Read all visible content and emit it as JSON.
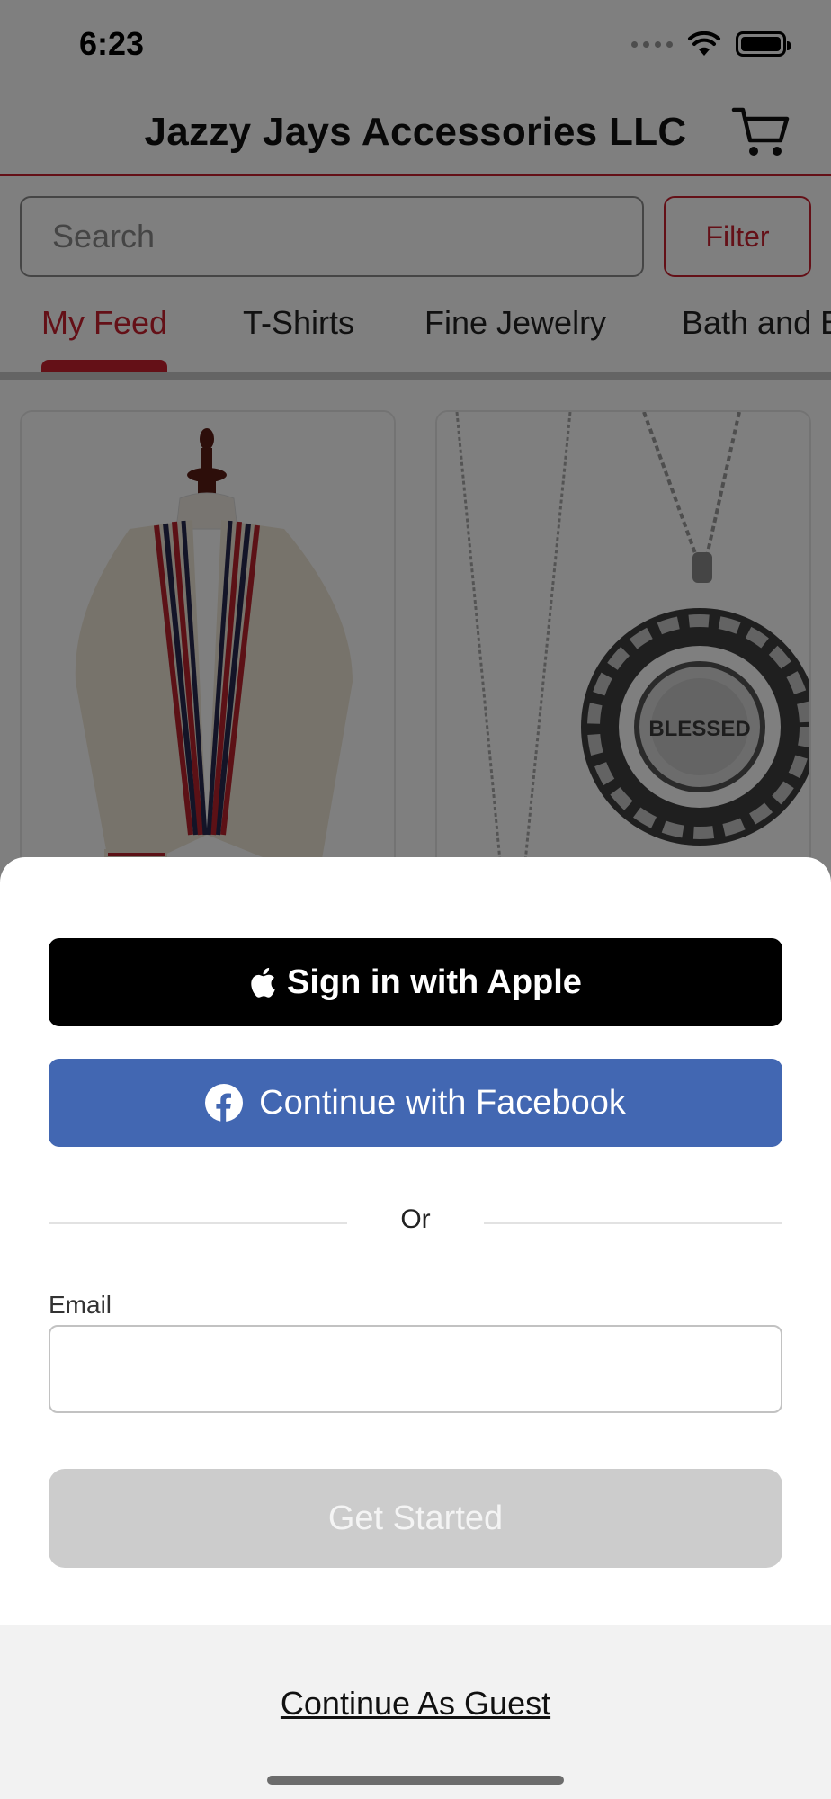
{
  "status_bar": {
    "time": "6:23"
  },
  "header": {
    "title": "Jazzy Jays Accessories LLC"
  },
  "search": {
    "placeholder": "Search",
    "filter_label": "Filter"
  },
  "tabs": [
    {
      "label": "My Feed",
      "active": true
    },
    {
      "label": "T-Shirts",
      "active": false
    },
    {
      "label": "Fine Jewelry",
      "active": false
    },
    {
      "label": "Bath and B",
      "active": false
    }
  ],
  "products": [
    {
      "image": "striped-vest-on-mannequin"
    },
    {
      "image": "blessed-pendant-necklace",
      "engraving": "BLESSED"
    }
  ],
  "sheet": {
    "apple_label": "Sign in with Apple",
    "facebook_label": "Continue with Facebook",
    "or_text": "Or",
    "email_label": "Email",
    "email_value": "",
    "get_started_label": "Get Started",
    "guest_label": "Continue As Guest"
  },
  "colors": {
    "accent_red": "#c8202e",
    "facebook_blue": "#4267b2",
    "disabled_gray": "#cccccc"
  }
}
